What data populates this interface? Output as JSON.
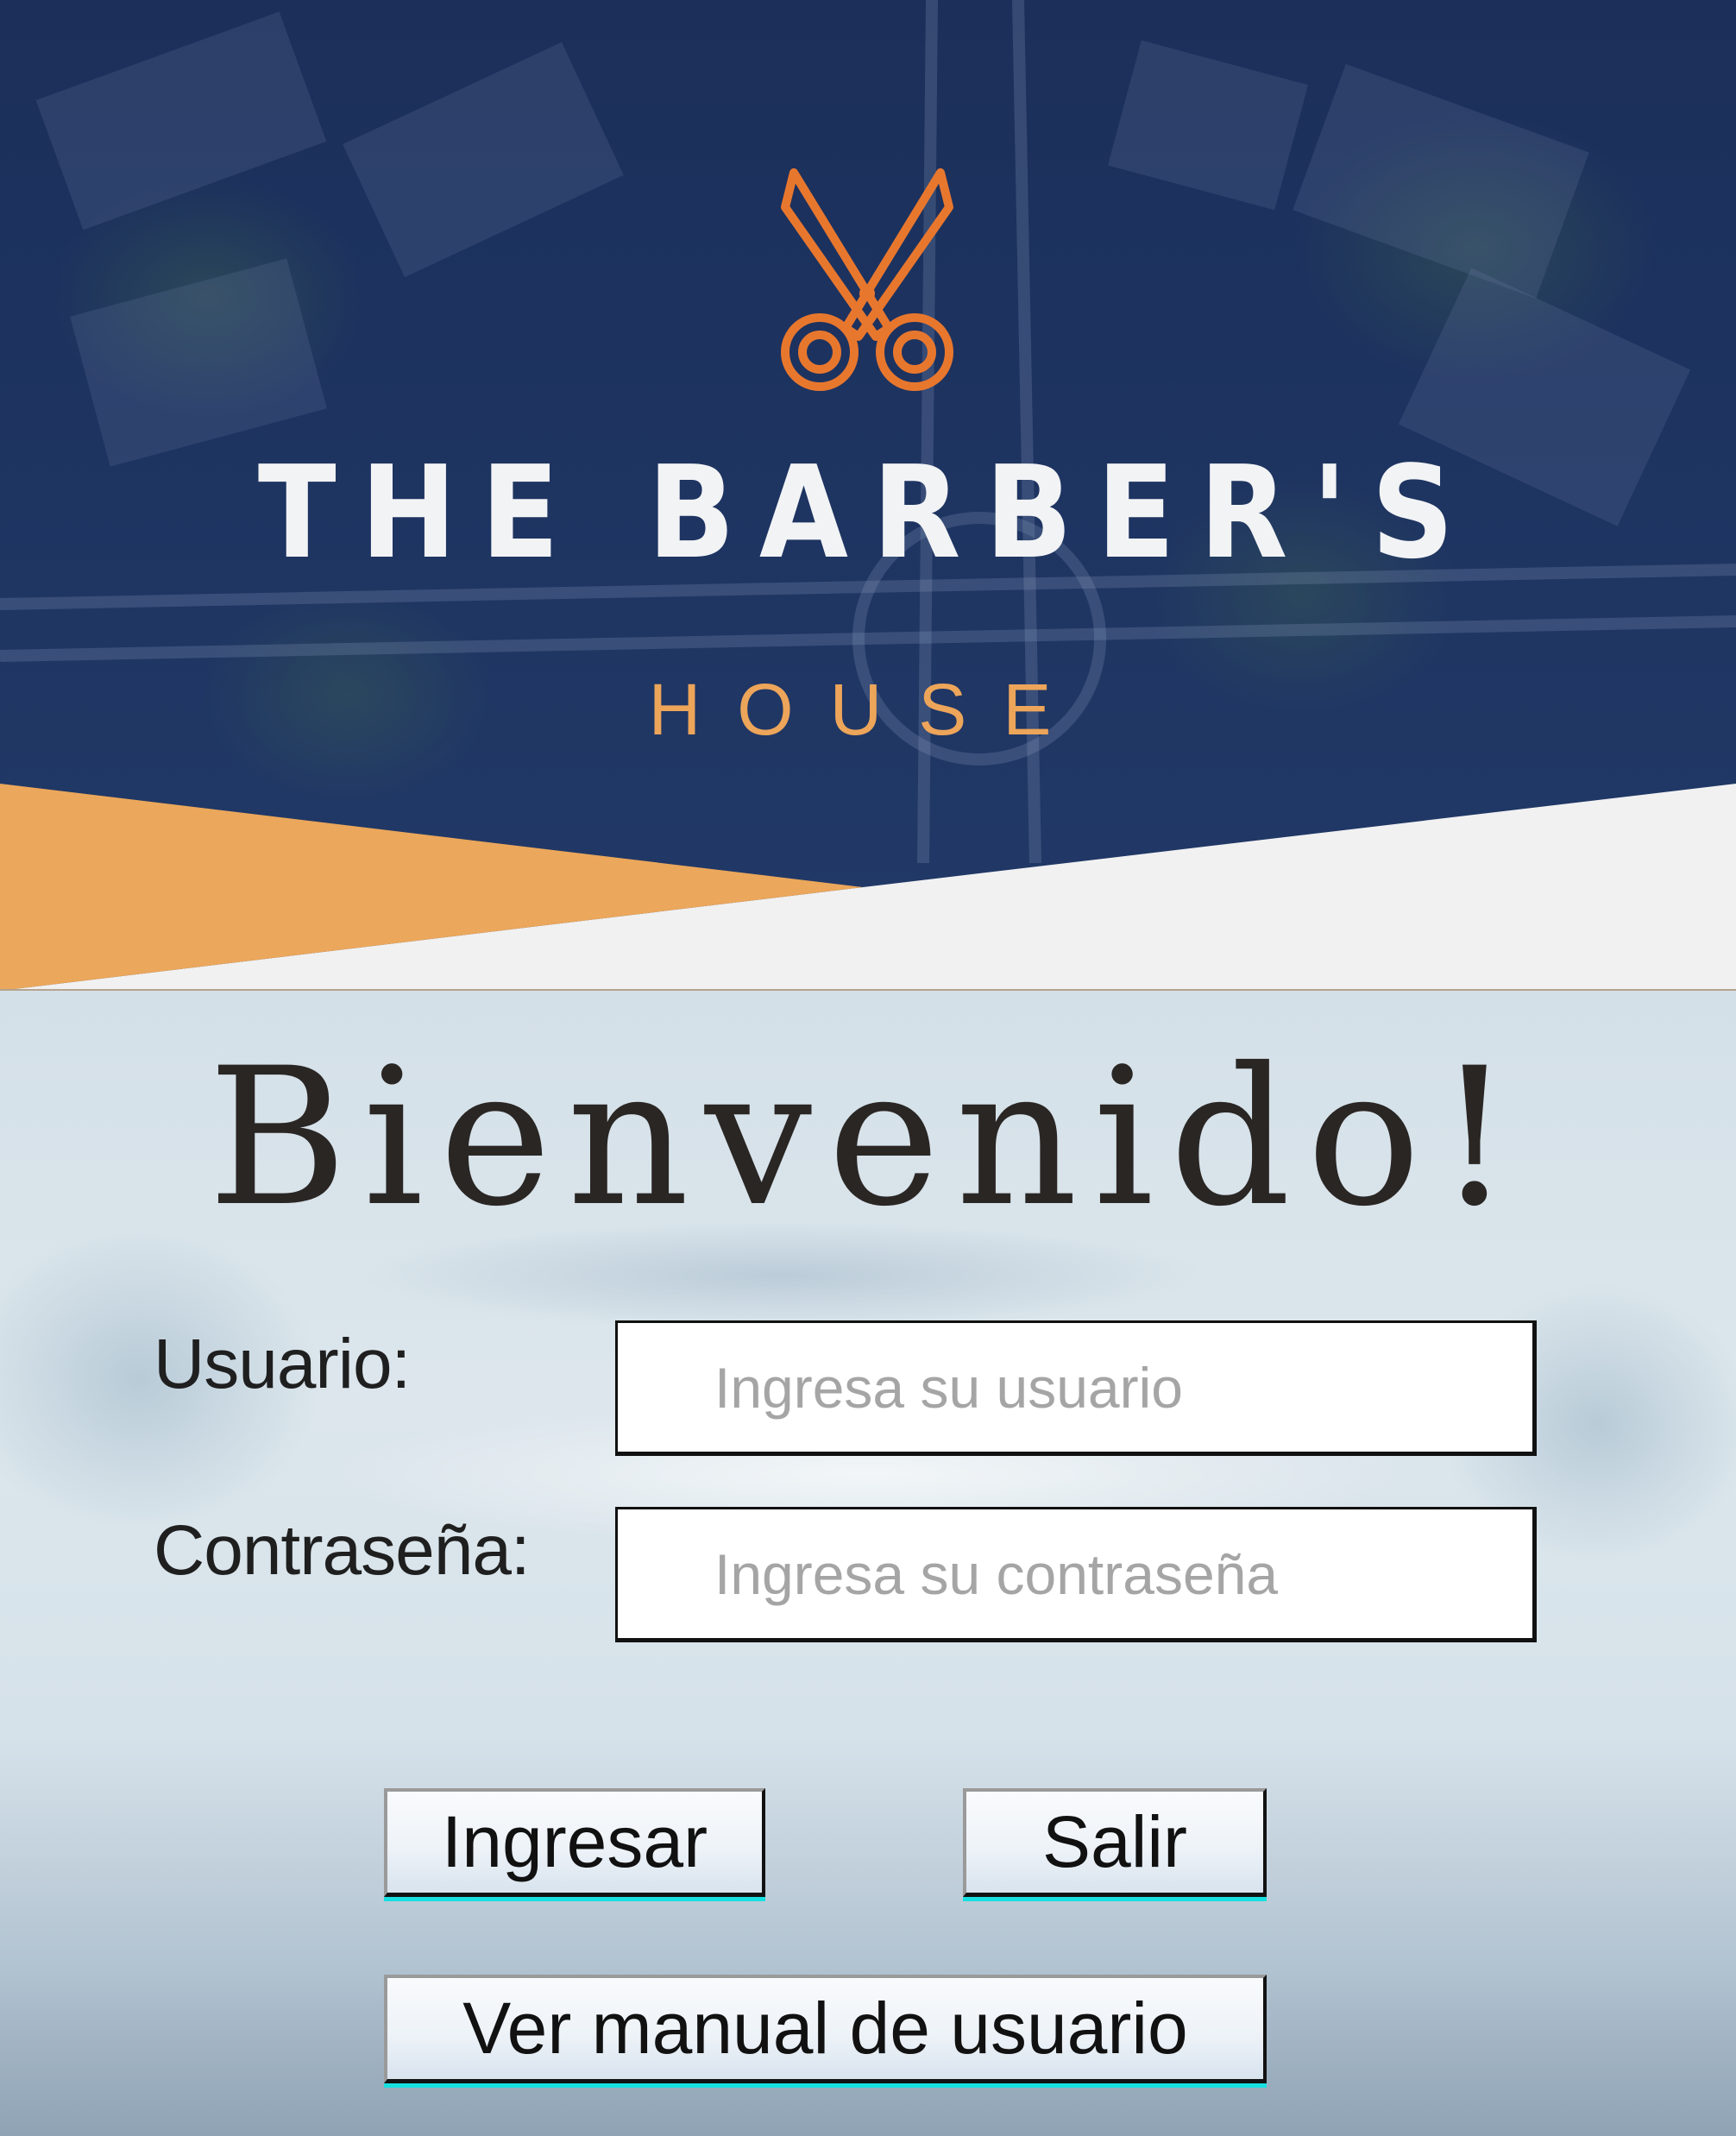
{
  "brand": {
    "title": "THE BARBER'S",
    "subtitle": "HOUSE",
    "logo_icon": "scissors-icon",
    "accent_color": "#eda55a",
    "logo_color": "#e8772e",
    "banner_color": "#1d3260"
  },
  "login": {
    "welcome": "Bienvenido!",
    "user_label": "Usuario:",
    "user_placeholder": "Ingresa su usuario",
    "user_value": "",
    "password_label": "Contraseña:",
    "password_placeholder": "Ingresa su contraseña",
    "password_value": "",
    "login_button": "Ingresar",
    "exit_button": "Salir",
    "manual_button": "Ver manual de usuario"
  }
}
